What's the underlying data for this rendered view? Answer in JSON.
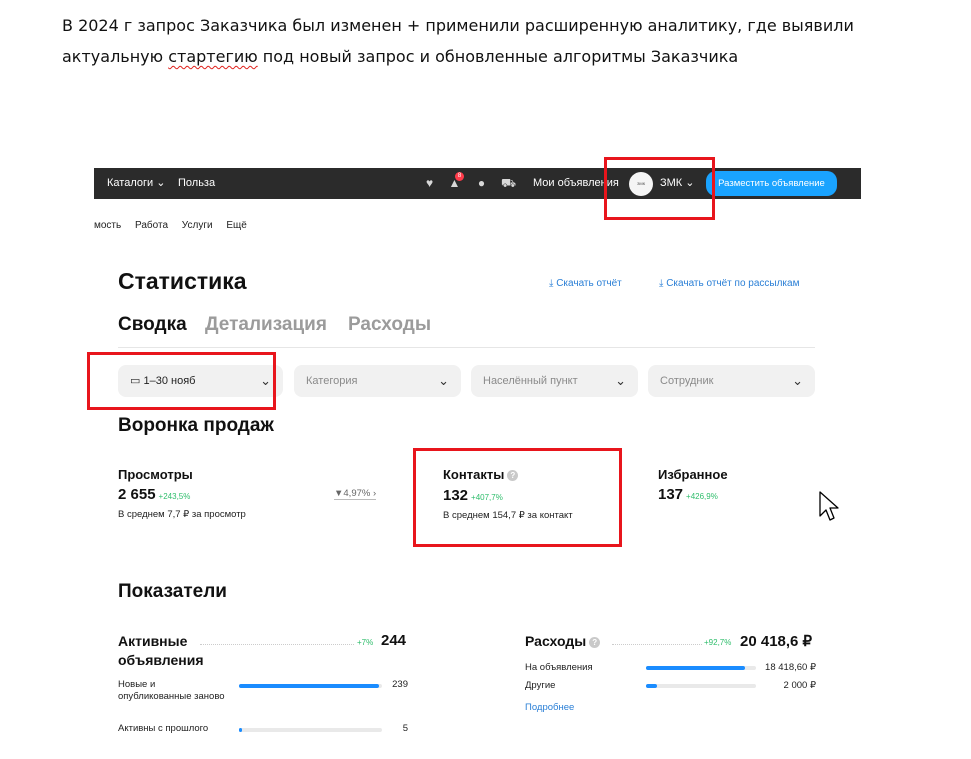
{
  "doc": {
    "line1": "В 2024 г запрос Заказчика был изменен + применили расширенную аналитику, где выявили",
    "line2_before": "актуальную ",
    "line2_misspelled": "стартегию",
    "line2_after": " под новый запрос и обновленные алгоритмы Заказчика"
  },
  "topbar": {
    "catalogs": "Каталоги",
    "catalogs_caret": "⌄",
    "polza": "Польза",
    "notif_count": "8",
    "my_ads": "Мои объявления",
    "account": "ЗМК",
    "account_caret": "⌄",
    "post_button": "Разместить объявление"
  },
  "subnav": [
    "мость",
    "Работа",
    "Услуги",
    "Ещё"
  ],
  "page": {
    "title": "Статистика",
    "download_report": "Скачать отчёт",
    "download_mailing_report": "Скачать отчёт по рассылкам",
    "tabs": [
      "Сводка",
      "Детализация",
      "Расходы"
    ]
  },
  "filters": {
    "date": "1–30 нояб",
    "category": "Категория",
    "locality": "Населённый пункт",
    "employee": "Сотрудник"
  },
  "funnel": {
    "title": "Воронка продаж",
    "views": {
      "label": "Просмотры",
      "value": "2 655",
      "delta": "+243,5%",
      "sub": "В среднем 7,7 ₽ за просмотр"
    },
    "conversion": "▼4,97% ›",
    "contacts": {
      "label": "Контакты",
      "value": "132",
      "delta": "+407,7%",
      "sub": "В среднем 154,7 ₽ за контакт"
    },
    "favorites": {
      "label": "Избранное",
      "value": "137",
      "delta": "+426,9%"
    }
  },
  "indicators": {
    "title": "Показатели",
    "active_ads": {
      "title": "Активные объявления",
      "delta": "+7%",
      "total": "244",
      "rows": [
        {
          "label": "Новые и опубликованные заново",
          "value": "239",
          "fill": 0.98
        },
        {
          "label": "Активны с прошлого",
          "value": "5",
          "fill": 0.02
        }
      ]
    },
    "expenses": {
      "title": "Расходы",
      "delta": "+92,7%",
      "total": "20 418,6 ₽",
      "rows": [
        {
          "label": "На объявления",
          "value": "18 418,60 ₽",
          "fill": 0.9
        },
        {
          "label": "Другие",
          "value": "2 000 ₽",
          "fill": 0.1
        }
      ],
      "more": "Подробнее"
    }
  }
}
